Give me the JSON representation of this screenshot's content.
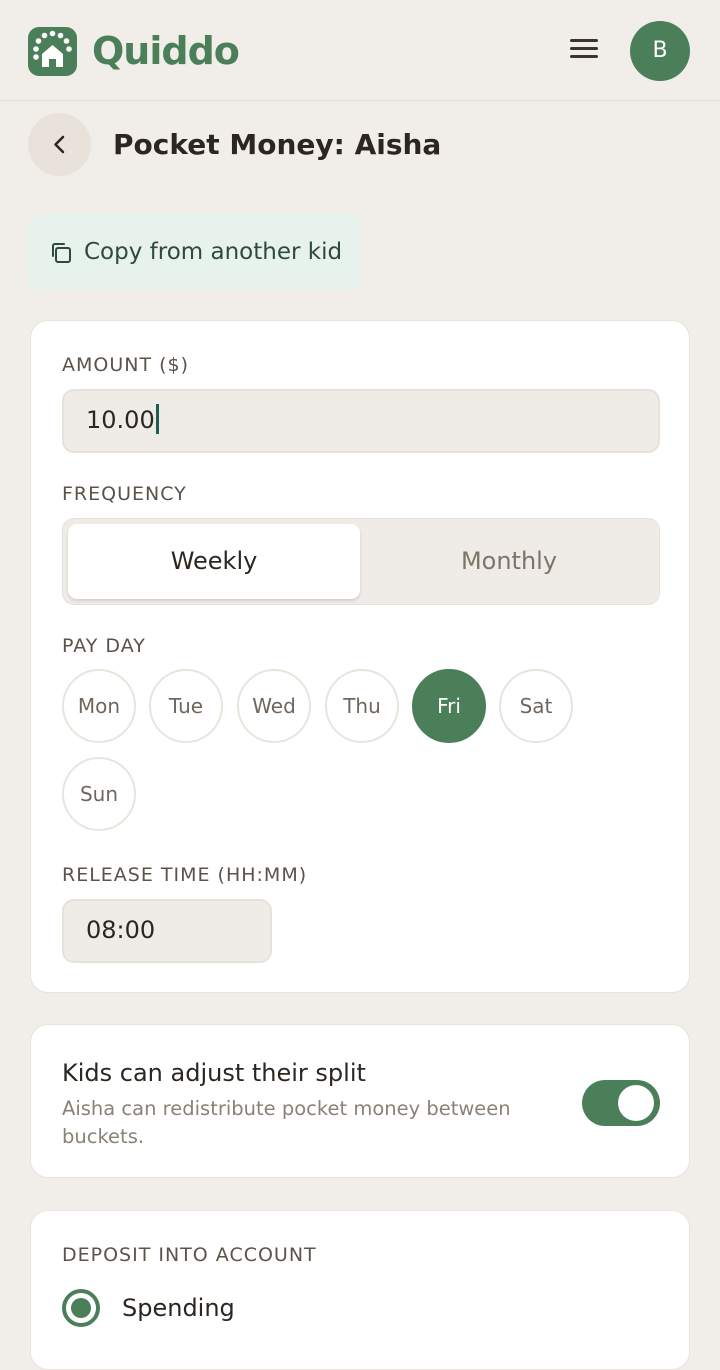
{
  "app": {
    "brand": "Quiddo",
    "avatar_initial": "B"
  },
  "header": {
    "title": "Pocket Money: Aisha"
  },
  "copy_button": {
    "label": "Copy from another kid"
  },
  "amount": {
    "label": "AMOUNT ($)",
    "value": "10.00"
  },
  "frequency": {
    "label": "FREQUENCY",
    "options": [
      "Weekly",
      "Monthly"
    ],
    "selected": "Weekly"
  },
  "payday": {
    "label": "PAY DAY",
    "days": [
      "Mon",
      "Tue",
      "Wed",
      "Thu",
      "Fri",
      "Sat",
      "Sun"
    ],
    "selected": "Fri"
  },
  "release_time": {
    "label": "RELEASE TIME (HH:MM)",
    "value": "08:00"
  },
  "split": {
    "title": "Kids can adjust their split",
    "description": "Aisha can redistribute pocket money between buckets.",
    "enabled": true
  },
  "deposit": {
    "label": "DEPOSIT INTO ACCOUNT",
    "options": [
      "Spending"
    ],
    "selected": "Spending"
  },
  "colors": {
    "accent": "#4A7F5A",
    "background": "#F1EEE9",
    "copy_bg": "#E7F2EC"
  }
}
